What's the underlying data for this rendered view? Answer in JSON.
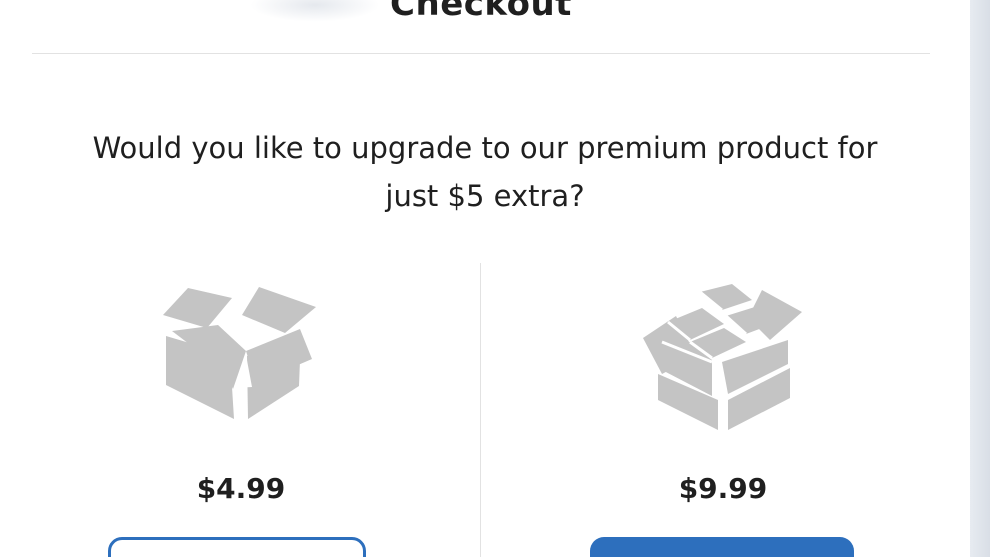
{
  "checkout": {
    "title": "Checkout",
    "question": "Would you like to upgrade to our premium product for just $5 extra?"
  },
  "options": [
    {
      "icon": "open-box-icon",
      "price": "$4.99"
    },
    {
      "icon": "box-of-packages-icon",
      "price": "$9.99"
    }
  ],
  "colors": {
    "accent": "#2d6fbd",
    "icon_gray": "#c4c4c4",
    "text": "#1f1f1f",
    "divider": "#e2e2e2"
  }
}
